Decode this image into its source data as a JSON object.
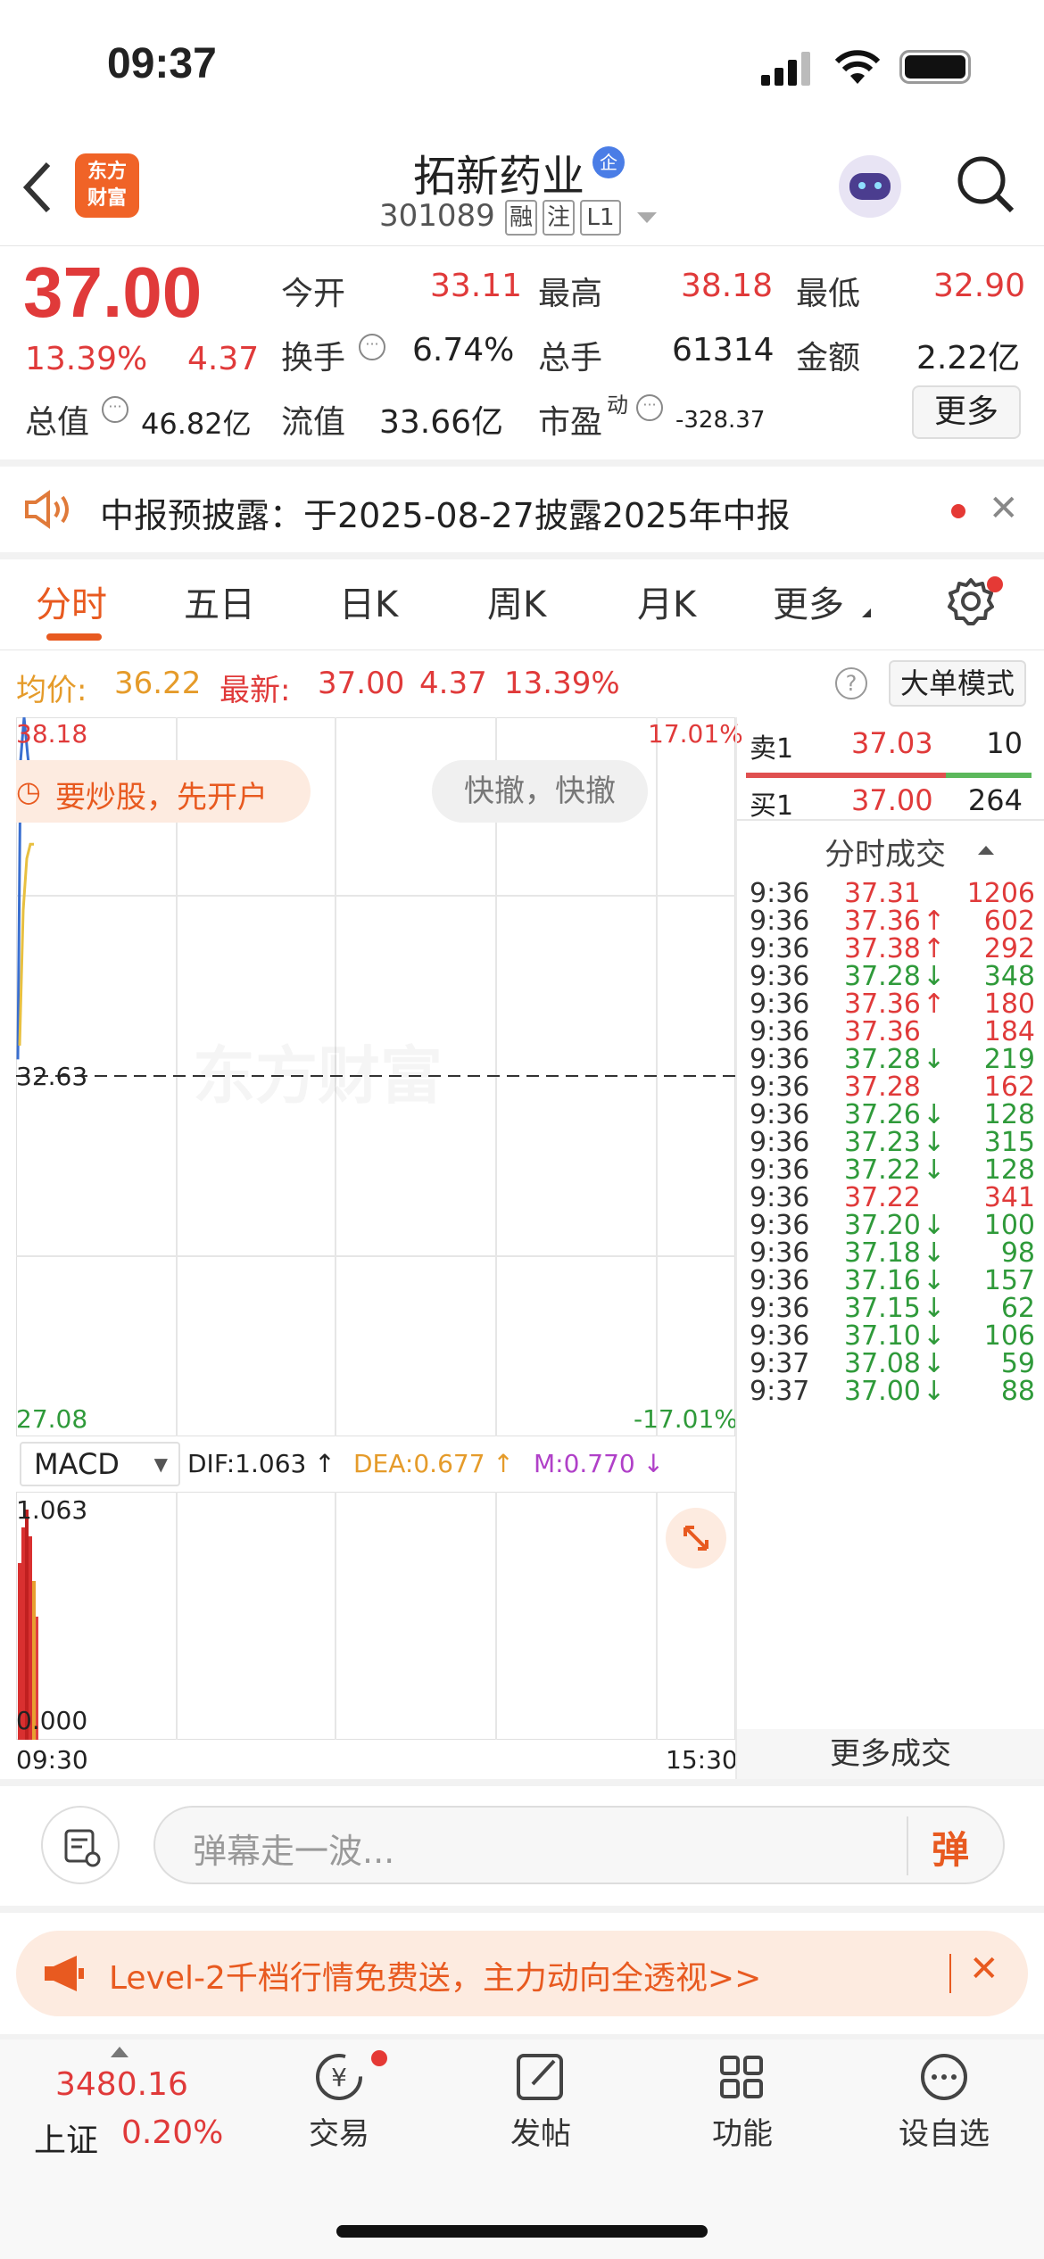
{
  "status": {
    "time": "09:37"
  },
  "header": {
    "back_icon": "chevron-left-icon",
    "logo_text_1": "东方",
    "logo_text_2": "财富",
    "title": "拓新药业",
    "badge": "企",
    "code": "301089",
    "tags": [
      "融",
      "注",
      "L1"
    ],
    "search_icon": "search-icon"
  },
  "quote": {
    "price": "37.00",
    "change_pct": "13.39%",
    "change": "4.37",
    "open_label": "今开",
    "open": "33.11",
    "high_label": "最高",
    "high": "38.18",
    "low_label": "最低",
    "low": "32.90",
    "turnover_label": "换手",
    "turnover": "6.74%",
    "volume_label": "总手",
    "volume": "61314",
    "amount_label": "金额",
    "amount": "2.22亿",
    "mktcap_label": "总值",
    "mktcap": "46.82亿",
    "float_label": "流值",
    "float": "33.66亿",
    "pe_label": "市盈",
    "pe_sup": "动",
    "pe": "-328.37",
    "more_button": "更多"
  },
  "notice": {
    "text": "中报预披露：于2025-08-27披露2025年中报"
  },
  "tabs": [
    "分时",
    "五日",
    "日K",
    "周K",
    "月K",
    "更多"
  ],
  "info_bar": {
    "avg_label": "均价:",
    "avg": "36.22",
    "latest_label": "最新:",
    "latest": "37.00",
    "change": "4.37",
    "pct": "13.39%",
    "mode_button": "大单模式"
  },
  "chart": {
    "y_top": "38.18",
    "y_mid": "32.63",
    "y_bottom": "27.08",
    "pct_top": "17.01%",
    "pct_bottom": "-17.01%",
    "promo": "要炒股，先开户",
    "quick": "快撤，快撤",
    "watermark": "东方财富",
    "macd_select": "MACD",
    "dif": "DIF:1.063 ↑",
    "dea": "DEA:0.677 ↑",
    "m": "M:0.770 ↓",
    "macd_top": "1.063",
    "macd_bottom": "0.000",
    "time_start": "09:30",
    "time_end": "15:30"
  },
  "chart_data": {
    "type": "line",
    "series": [
      {
        "values": [
          32.9,
          37.5,
          38.18,
          37.6,
          37.0
        ]
      },
      {
        "values": [
          33.11,
          35.2,
          36.0,
          36.22,
          36.22
        ]
      }
    ],
    "ylim": [
      27.08,
      38.18
    ]
  },
  "orderbook": {
    "sell_label": "卖1",
    "sell_price": "37.03",
    "sell_vol": "10",
    "buy_label": "买1",
    "buy_price": "37.00",
    "buy_vol": "264"
  },
  "trades_header": "分时成交",
  "trades": [
    {
      "t": "9:36",
      "p": "37.31",
      "a": "",
      "v": "1206",
      "c": "red"
    },
    {
      "t": "9:36",
      "p": "37.36",
      "a": "↑",
      "v": "602",
      "c": "red"
    },
    {
      "t": "9:36",
      "p": "37.38",
      "a": "↑",
      "v": "292",
      "c": "red"
    },
    {
      "t": "9:36",
      "p": "37.28",
      "a": "↓",
      "v": "348",
      "c": "green"
    },
    {
      "t": "9:36",
      "p": "37.36",
      "a": "↑",
      "v": "180",
      "c": "red"
    },
    {
      "t": "9:36",
      "p": "37.36",
      "a": "",
      "v": "184",
      "c": "red"
    },
    {
      "t": "9:36",
      "p": "37.28",
      "a": "↓",
      "v": "219",
      "c": "green"
    },
    {
      "t": "9:36",
      "p": "37.28",
      "a": "",
      "v": "162",
      "c": "red"
    },
    {
      "t": "9:36",
      "p": "37.26",
      "a": "↓",
      "v": "128",
      "c": "green"
    },
    {
      "t": "9:36",
      "p": "37.23",
      "a": "↓",
      "v": "315",
      "c": "green"
    },
    {
      "t": "9:36",
      "p": "37.22",
      "a": "↓",
      "v": "128",
      "c": "green"
    },
    {
      "t": "9:36",
      "p": "37.22",
      "a": "",
      "v": "341",
      "c": "red"
    },
    {
      "t": "9:36",
      "p": "37.20",
      "a": "↓",
      "v": "100",
      "c": "green"
    },
    {
      "t": "9:36",
      "p": "37.18",
      "a": "↓",
      "v": "98",
      "c": "green"
    },
    {
      "t": "9:36",
      "p": "37.16",
      "a": "↓",
      "v": "157",
      "c": "green"
    },
    {
      "t": "9:36",
      "p": "37.15",
      "a": "↓",
      "v": "62",
      "c": "green"
    },
    {
      "t": "9:36",
      "p": "37.10",
      "a": "↓",
      "v": "106",
      "c": "green"
    },
    {
      "t": "9:37",
      "p": "37.08",
      "a": "↓",
      "v": "59",
      "c": "green"
    },
    {
      "t": "9:37",
      "p": "37.00",
      "a": "↓",
      "v": "88",
      "c": "green"
    }
  ],
  "more_trades": "更多成交",
  "comment": {
    "placeholder": "弹幕走一波...",
    "danmu": "弹"
  },
  "banner": {
    "text": "Level-2千档行情免费送，主力动向全透视>>"
  },
  "bottom_nav": {
    "index_value": "3480.16",
    "index_name": "上证",
    "index_pct": "0.20%",
    "items": [
      "交易",
      "发帖",
      "功能",
      "设自选"
    ]
  }
}
